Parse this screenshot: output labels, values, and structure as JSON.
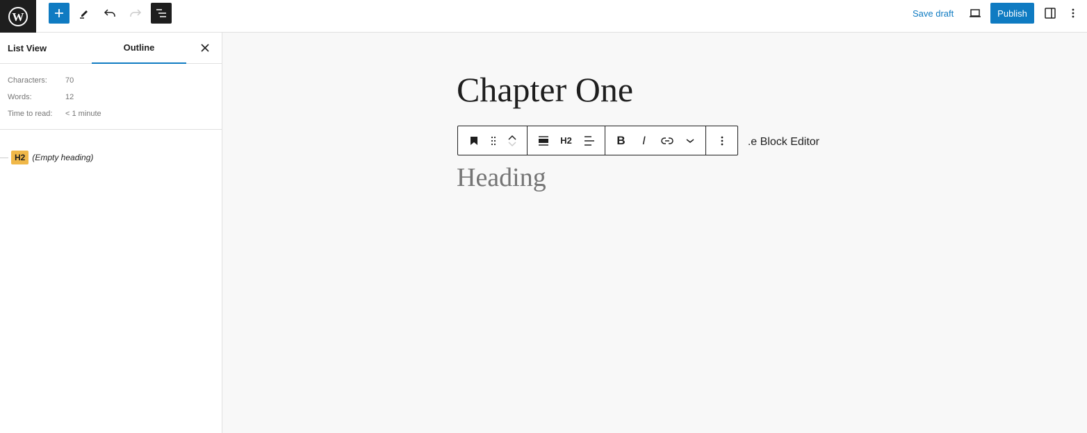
{
  "topbar": {
    "save_draft": "Save draft",
    "publish": "Publish",
    "icons": [
      "wordpress-logo",
      "plus-icon",
      "pencil-icon",
      "undo-icon",
      "redo-icon",
      "document-overview-icon",
      "desktop-preview-icon",
      "sidebar-toggle-icon",
      "more-vertical-icon"
    ]
  },
  "sidebar": {
    "tabs": [
      {
        "label": "List View"
      },
      {
        "label": "Outline",
        "active": true
      }
    ],
    "stats": [
      {
        "label": "Characters:",
        "value": "70"
      },
      {
        "label": "Words:",
        "value": "12"
      },
      {
        "label": "Time to read:",
        "value": "< 1 minute"
      }
    ],
    "outline": [
      {
        "level": "H2",
        "text": "(Empty heading)"
      }
    ]
  },
  "editor": {
    "title": "Chapter One",
    "paragraph_visible": "e Block Editor.",
    "heading_placeholder": "Heading",
    "toolbar": {
      "heading_level": "H2",
      "bold": "B",
      "italic": "I"
    }
  },
  "colors": {
    "accent": "#0f7bc2",
    "badge": "#f0b849",
    "dark": "#1e1e1e"
  }
}
